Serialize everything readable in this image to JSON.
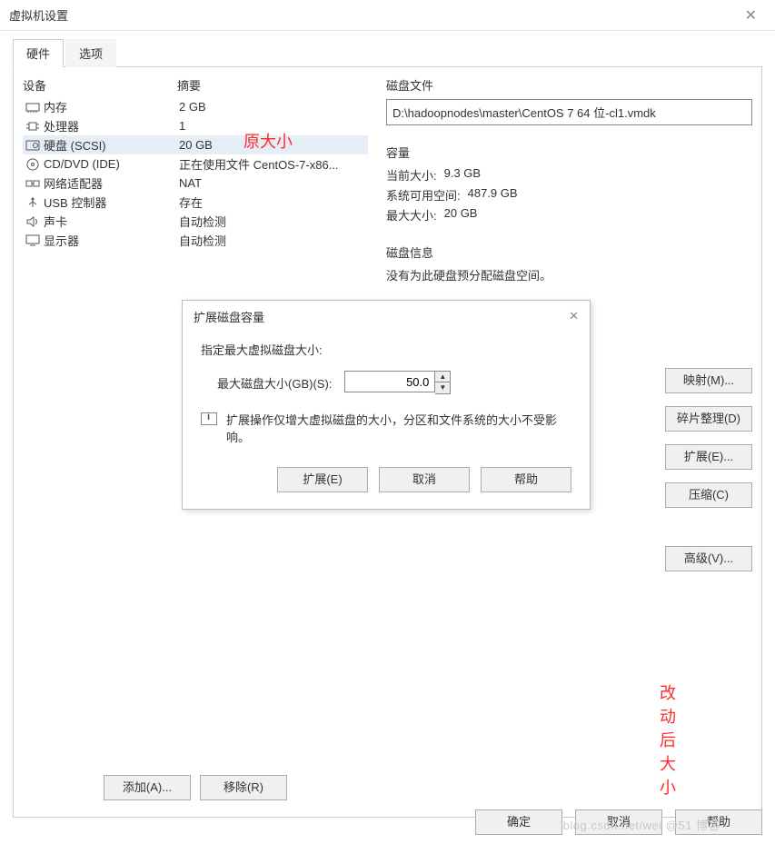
{
  "window": {
    "title": "虚拟机设置",
    "tabs": {
      "hardware": "硬件",
      "options": "选项"
    },
    "footer": {
      "ok": "确定",
      "cancel": "取消",
      "help": "帮助"
    }
  },
  "headers": {
    "device": "设备",
    "summary": "摘要"
  },
  "devices": [
    {
      "name": "内存",
      "summary": "2 GB",
      "icon": "memory"
    },
    {
      "name": "处理器",
      "summary": "1",
      "icon": "cpu"
    },
    {
      "name": "硬盘 (SCSI)",
      "summary": "20 GB",
      "icon": "disk",
      "selected": true
    },
    {
      "name": "CD/DVD (IDE)",
      "summary": "正在使用文件 CentOS-7-x86...",
      "icon": "cd"
    },
    {
      "name": "网络适配器",
      "summary": "NAT",
      "icon": "net"
    },
    {
      "name": "USB 控制器",
      "summary": "存在",
      "icon": "usb"
    },
    {
      "name": "声卡",
      "summary": "自动检测",
      "icon": "sound"
    },
    {
      "name": "显示器",
      "summary": "自动检测",
      "icon": "display"
    }
  ],
  "left_buttons": {
    "add": "添加(A)...",
    "remove": "移除(R)"
  },
  "annotations": {
    "original_size": "原大小",
    "after_change": "改动后大小"
  },
  "right": {
    "disk_file_title": "磁盘文件",
    "disk_file_path": "D:\\hadoopnodes\\master\\CentOS 7 64 位-cl1.vmdk",
    "capacity_title": "容量",
    "capacity": {
      "current_label": "当前大小:",
      "current_value": "9.3 GB",
      "free_label": "系统可用空间:",
      "free_value": "487.9 GB",
      "max_label": "最大大小:",
      "max_value": "20 GB"
    },
    "disk_info_title": "磁盘信息",
    "disk_info_line": "没有为此硬盘预分配磁盘空间。",
    "side_buttons": {
      "map": "映射(M)...",
      "defrag": "碎片整理(D)",
      "expand": "扩展(E)...",
      "compress": "压缩(C)",
      "advanced": "高级(V)..."
    }
  },
  "dialog": {
    "title": "扩展磁盘容量",
    "instruction": "指定最大虚拟磁盘大小:",
    "size_label": "最大磁盘大小(GB)(S):",
    "size_value": "50.0",
    "note": "扩展操作仅增大虚拟磁盘的大小，分区和文件系统的大小不受影响。",
    "buttons": {
      "expand": "扩展(E)",
      "cancel": "取消",
      "help": "帮助"
    }
  },
  "watermark": "blog.csdn.net/wei @51 博客"
}
